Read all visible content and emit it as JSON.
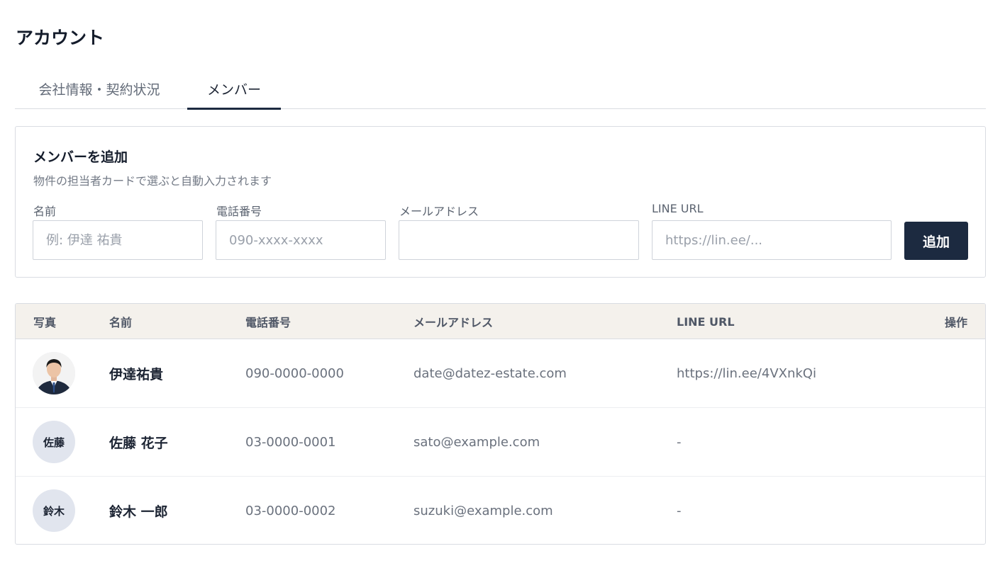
{
  "page": {
    "title": "アカウント"
  },
  "tabs": [
    {
      "label": "会社情報・契約状況",
      "active": false
    },
    {
      "label": "メンバー",
      "active": true
    }
  ],
  "add_member": {
    "title": "メンバーを追加",
    "subtitle": "物件の担当者カードで選ぶと自動入力されます",
    "fields": {
      "name": {
        "label": "名前",
        "placeholder": "例: 伊達 祐貴",
        "value": ""
      },
      "phone": {
        "label": "電話番号",
        "placeholder": "090-xxxx-xxxx",
        "value": ""
      },
      "email": {
        "label": "メールアドレス",
        "placeholder": "",
        "value": ""
      },
      "line": {
        "label": "LINE URL",
        "placeholder": "https://lin.ee/...",
        "value": ""
      }
    },
    "button_label": "追加"
  },
  "table": {
    "headers": {
      "photo": "写真",
      "name": "名前",
      "phone": "電話番号",
      "email": "メールアドレス",
      "line": "LINE URL",
      "actions": "操作"
    },
    "rows": [
      {
        "avatar_text": "",
        "avatar_icon": "person-photo",
        "name": "伊達祐貴",
        "phone": "090-0000-0000",
        "email": "date@datez-estate.com",
        "line": "https://lin.ee/4VXnkQi"
      },
      {
        "avatar_text": "佐藤",
        "name": "佐藤 花子",
        "phone": "03-0000-0001",
        "email": "sato@example.com",
        "line": "-"
      },
      {
        "avatar_text": "鈴木",
        "name": "鈴木 一郎",
        "phone": "03-0000-0002",
        "email": "suzuki@example.com",
        "line": "-"
      }
    ]
  },
  "colors": {
    "primary": "#1c2a40",
    "header_bg": "#f4f1ec",
    "avatar_bg": "#e1e5ee",
    "border": "#d9dce2"
  }
}
